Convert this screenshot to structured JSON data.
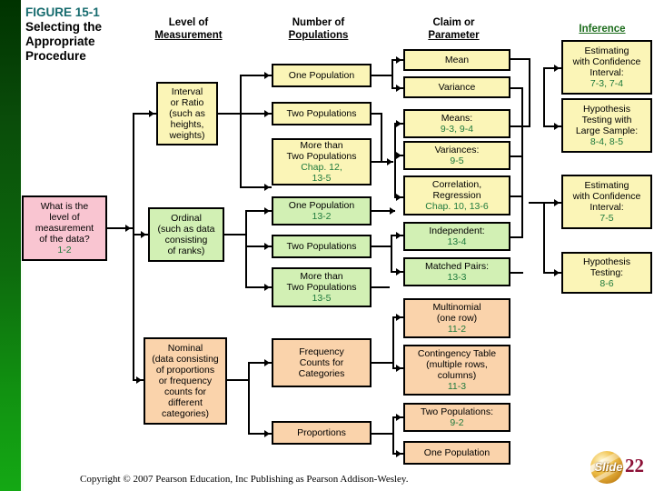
{
  "figure": {
    "label": "FIGURE 15-1",
    "title_line1": "Selecting the",
    "title_line2": "Appropriate",
    "title_line3": "Procedure"
  },
  "columns": [
    {
      "name": "level-of-measurement",
      "line1": "Level of",
      "line2": "Measurement"
    },
    {
      "name": "number-of-populations",
      "line1": "Number of",
      "line2": "Populations"
    },
    {
      "name": "claim-or-parameter",
      "line1": "Claim  or",
      "line2": "Parameter"
    },
    {
      "name": "inference",
      "line1": "",
      "line2": "Inference"
    }
  ],
  "colors": {
    "yellow": "#fbf5b7",
    "pink": "#f9c5d1",
    "green": "#d2f0b4",
    "peach": "#fad3ab",
    "reference_text": "#1f7a3d",
    "figure_label": "#166b6e",
    "inference_header": "#1a6b1a",
    "left_bar_top": "#003300",
    "left_bar_bottom": "#14a814"
  },
  "start_node": {
    "line1": "What is the",
    "line2": "level of",
    "line3": "measurement",
    "line4": "of the data?",
    "ref": "1-2"
  },
  "level_nodes": [
    {
      "id": "interval-or-ratio",
      "lines": [
        "Interval",
        "or Ratio",
        "(such as",
        "heights,",
        "weights)"
      ],
      "ref": ""
    },
    {
      "id": "ordinal",
      "lines": [
        "Ordinal",
        "(such as data",
        "consisting",
        "of  ranks)"
      ],
      "ref": ""
    },
    {
      "id": "nominal",
      "lines": [
        "Nominal",
        "(data consisting",
        "of proportions",
        "or frequency",
        "counts for",
        "different",
        "categories)"
      ],
      "ref": ""
    }
  ],
  "population_nodes": [
    {
      "id": "interval-one-population",
      "lines": [
        "One Population"
      ],
      "ref": ""
    },
    {
      "id": "interval-two-populations",
      "lines": [
        "Two Populations"
      ],
      "ref": ""
    },
    {
      "id": "interval-more-than-two",
      "lines": [
        "More than",
        "Two Populations"
      ],
      "ref": "Chap. 12,\n13-5"
    },
    {
      "id": "ordinal-one-population",
      "lines": [
        "One Population"
      ],
      "ref": "13-2"
    },
    {
      "id": "ordinal-two-populations",
      "lines": [
        "Two Populations"
      ],
      "ref": ""
    },
    {
      "id": "ordinal-more-than-two",
      "lines": [
        "More than",
        "Two Populations"
      ],
      "ref": "13-5"
    },
    {
      "id": "nominal-frequency-counts",
      "lines": [
        "Frequency",
        "Counts for",
        "Categories"
      ],
      "ref": ""
    },
    {
      "id": "nominal-proportions",
      "lines": [
        "Proportions"
      ],
      "ref": ""
    }
  ],
  "claim_nodes": [
    {
      "id": "mean",
      "lines": [
        "Mean"
      ],
      "ref": ""
    },
    {
      "id": "variance",
      "lines": [
        "Variance"
      ],
      "ref": ""
    },
    {
      "id": "means",
      "lines": [
        "Means:"
      ],
      "ref": "9-3, 9-4"
    },
    {
      "id": "variances",
      "lines": [
        "Variances:"
      ],
      "ref": "9-5"
    },
    {
      "id": "correlation-regression",
      "lines": [
        "Correlation,",
        "Regression"
      ],
      "ref": "Chap. 10,  13-6"
    },
    {
      "id": "independent",
      "lines": [
        "Independent:"
      ],
      "ref": "13-4"
    },
    {
      "id": "matched-pairs",
      "lines": [
        "Matched Pairs:"
      ],
      "ref": "13-3"
    },
    {
      "id": "multinomial",
      "lines": [
        "Multinomial",
        "(one  row)"
      ],
      "ref": "11-2"
    },
    {
      "id": "contingency-table",
      "lines": [
        "Contingency Table",
        "(multiple  rows,",
        "columns)"
      ],
      "ref": "11-3"
    },
    {
      "id": "two-populations-claim",
      "lines": [
        "Two  Populations:"
      ],
      "ref": "9-2"
    },
    {
      "id": "one-population-claim",
      "lines": [
        "One  Population"
      ],
      "ref": ""
    }
  ],
  "inference_nodes": [
    {
      "id": "estimating-ci-73-74",
      "lines": [
        "Estimating",
        "with Confidence",
        "Interval:"
      ],
      "ref": "7-3, 7-4"
    },
    {
      "id": "hypothesis-testing-large-sample",
      "lines": [
        "Hypothesis",
        "Testing with",
        "Large Sample:"
      ],
      "ref": "8-4, 8-5"
    },
    {
      "id": "estimating-ci-75",
      "lines": [
        "Estimating",
        "with Confidence",
        "Interval:"
      ],
      "ref": "7-5"
    },
    {
      "id": "hypothesis-testing-86",
      "lines": [
        "Hypothesis",
        "Testing:"
      ],
      "ref": "8-6"
    }
  ],
  "footer": {
    "copyright": "Copyright © 2007 Pearson Education, Inc Publishing as Pearson Addison-Wesley."
  },
  "slide": {
    "word": "Slide",
    "number": "22"
  }
}
